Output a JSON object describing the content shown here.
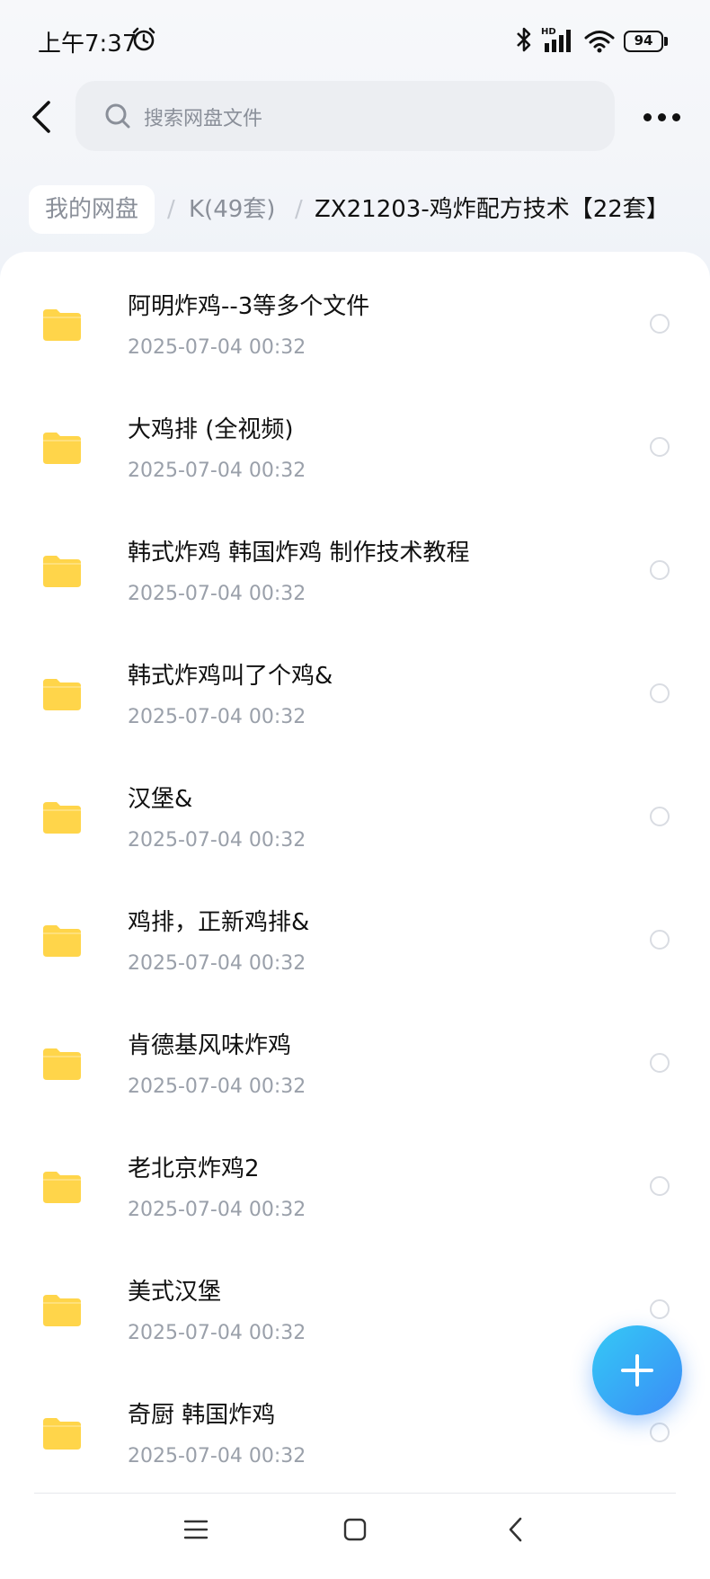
{
  "status_bar": {
    "time": "上午7:37",
    "battery": "94"
  },
  "header": {
    "search_placeholder": "搜索网盘文件"
  },
  "breadcrumb": {
    "root": "我的网盘",
    "separator": "/",
    "middle": "K(49套)",
    "current": "ZX21203-鸡炸配方技术【22套】"
  },
  "files": [
    {
      "name": "阿明炸鸡--3等多个文件",
      "date": "2025-07-04  00:32"
    },
    {
      "name": "大鸡排 (全视频)",
      "date": "2025-07-04  00:32"
    },
    {
      "name": "韩式炸鸡 韩国炸鸡 制作技术教程",
      "date": "2025-07-04  00:32"
    },
    {
      "name": "韩式炸鸡叫了个鸡&",
      "date": "2025-07-04  00:32"
    },
    {
      "name": "汉堡&",
      "date": "2025-07-04  00:32"
    },
    {
      "name": "鸡排，正新鸡排&",
      "date": "2025-07-04  00:32"
    },
    {
      "name": "肯德基风味炸鸡",
      "date": "2025-07-04  00:32"
    },
    {
      "name": "老北京炸鸡2",
      "date": "2025-07-04  00:32"
    },
    {
      "name": "美式汉堡",
      "date": "2025-07-04  00:32"
    },
    {
      "name": "奇厨 韩国炸鸡",
      "date": "2025-07-04  00:32"
    }
  ],
  "colors": {
    "folder": "#FFD54A",
    "fab_start": "#34C9F5",
    "fab_end": "#3B8CF7"
  },
  "icons": {
    "folder": "folder-icon",
    "add": "plus-icon",
    "more": "more-dots-icon"
  }
}
